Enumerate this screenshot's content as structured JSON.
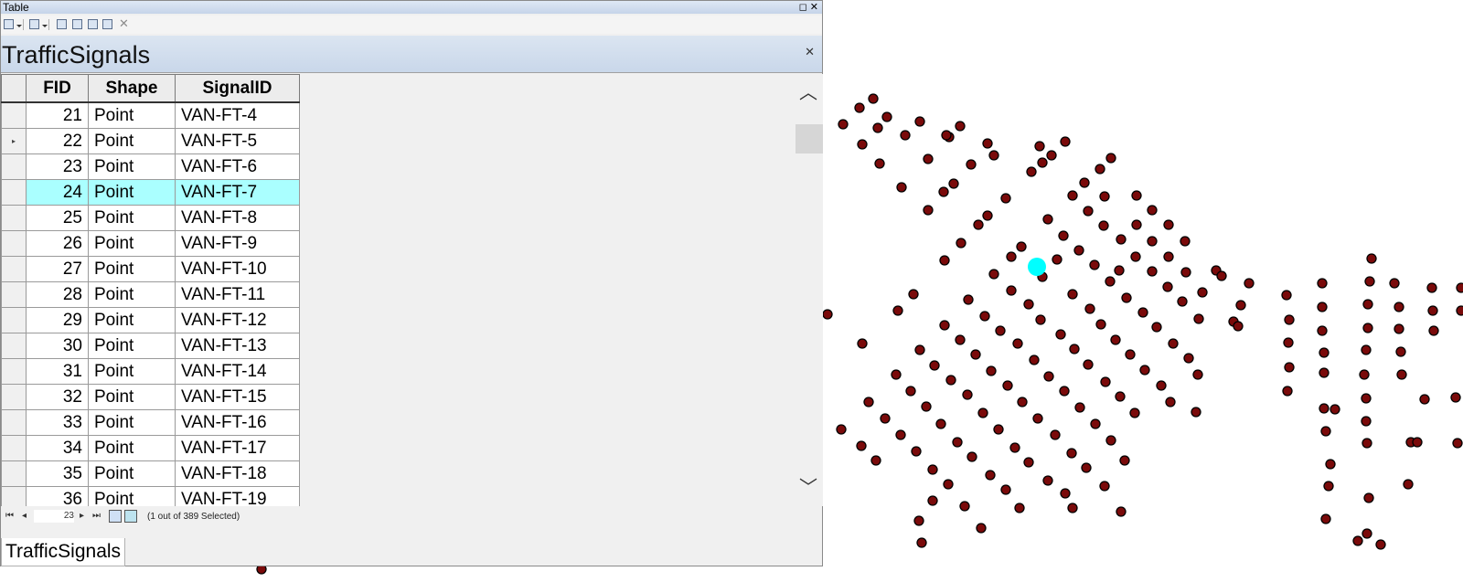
{
  "window": {
    "title": "Table"
  },
  "toolbar": {
    "items": [
      "table-options-icon",
      "related-tables-icon",
      "select-by-attributes-icon",
      "switch-selection-icon",
      "clear-selection-icon",
      "zoom-to-selected-icon",
      "delete-selected-icon"
    ]
  },
  "layer": {
    "tab_name": "TrafficSignals"
  },
  "table": {
    "columns": [
      "FID",
      "Shape",
      "SignalID"
    ],
    "rows": [
      {
        "fid": "21",
        "shape": "Point",
        "id": "VAN-FT-4"
      },
      {
        "fid": "22",
        "shape": "Point",
        "id": "VAN-FT-5"
      },
      {
        "fid": "23",
        "shape": "Point",
        "id": "VAN-FT-6"
      },
      {
        "fid": "24",
        "shape": "Point",
        "id": "VAN-FT-7"
      },
      {
        "fid": "25",
        "shape": "Point",
        "id": "VAN-FT-8"
      },
      {
        "fid": "26",
        "shape": "Point",
        "id": "VAN-FT-9"
      },
      {
        "fid": "27",
        "shape": "Point",
        "id": "VAN-FT-10"
      },
      {
        "fid": "28",
        "shape": "Point",
        "id": "VAN-FT-11"
      },
      {
        "fid": "29",
        "shape": "Point",
        "id": "VAN-FT-12"
      },
      {
        "fid": "30",
        "shape": "Point",
        "id": "VAN-FT-13"
      },
      {
        "fid": "31",
        "shape": "Point",
        "id": "VAN-FT-14"
      },
      {
        "fid": "32",
        "shape": "Point",
        "id": "VAN-FT-15"
      },
      {
        "fid": "33",
        "shape": "Point",
        "id": "VAN-FT-16"
      },
      {
        "fid": "34",
        "shape": "Point",
        "id": "VAN-FT-17"
      },
      {
        "fid": "35",
        "shape": "Point",
        "id": "VAN-FT-18"
      },
      {
        "fid": "36",
        "shape": "Point",
        "id": "VAN-FT-19"
      }
    ],
    "highlighted_fid": "24",
    "current_row_fid": "22"
  },
  "navigation": {
    "current_record": "23",
    "selection_status": "(1 out of 389 Selected)"
  },
  "bottom_tab": {
    "label": "TrafficSignals"
  },
  "map": {
    "point_color": "#7a0a0a",
    "selected_color": "#00ffff",
    "point_count": 389,
    "selected_count": 1
  }
}
